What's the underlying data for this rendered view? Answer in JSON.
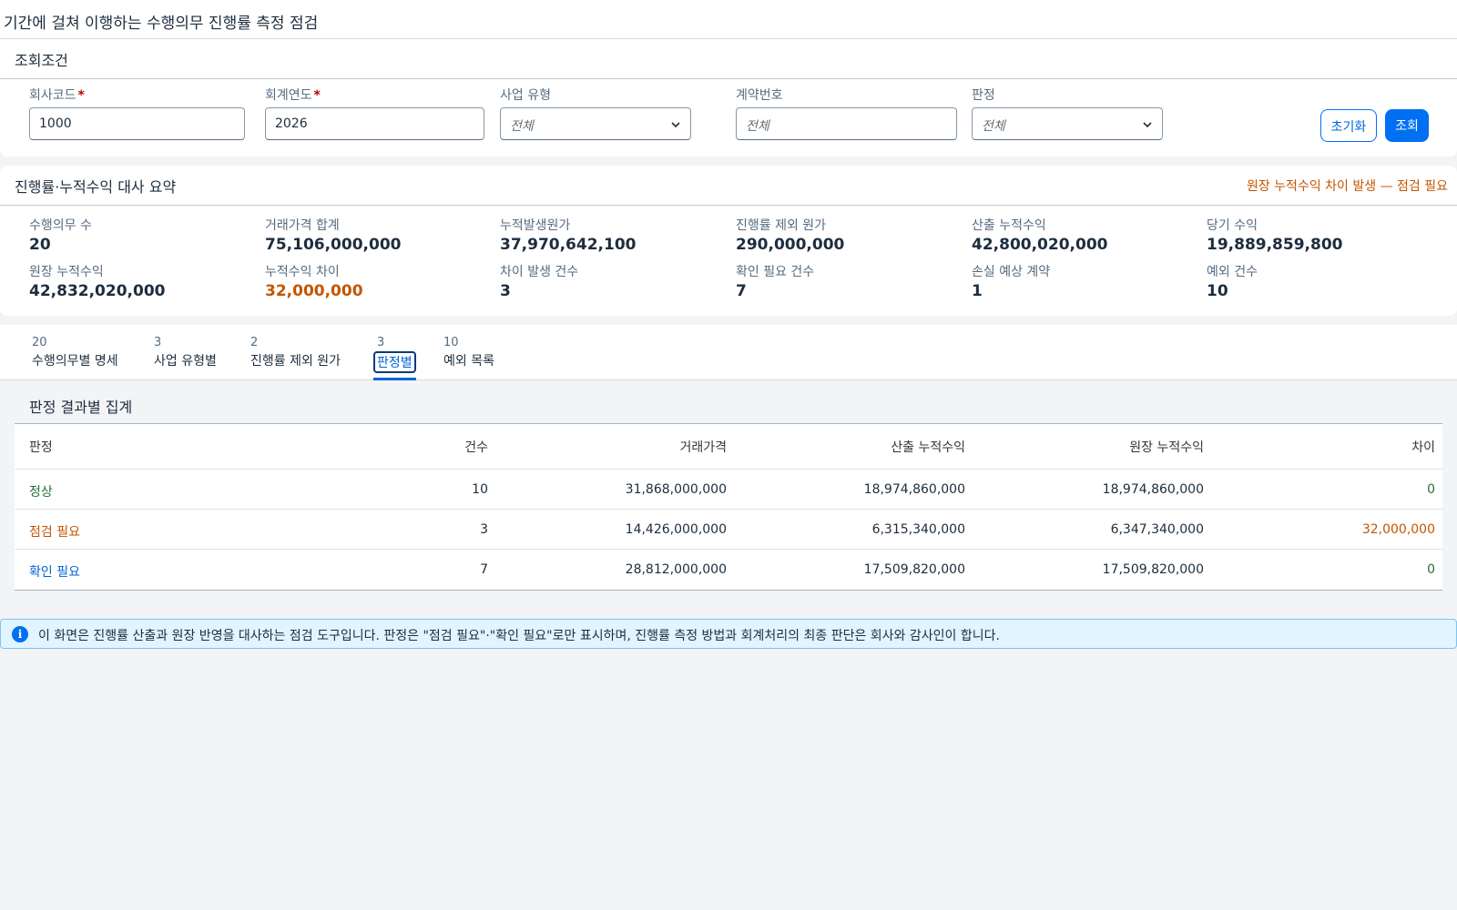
{
  "page": {
    "title": "기간에 걸쳐 이행하는 수행의무 진행률 측정 점검"
  },
  "filters": {
    "title": "조회조건",
    "company_code": {
      "label": "회사코드",
      "value": "1000"
    },
    "fiscal_year": {
      "label": "회계연도",
      "value": "2026"
    },
    "business_type": {
      "label": "사업 유형",
      "value": "전체"
    },
    "contract_no": {
      "label": "계약번호",
      "placeholder": "전체"
    },
    "judgment": {
      "label": "판정",
      "value": "전체"
    },
    "reset_label": "초기화",
    "search_label": "조회"
  },
  "summary": {
    "title": "진행률·누적수익 대사 요약",
    "alert": "원장 누적수익 차이 발생 — 점검 필요",
    "kpis": [
      {
        "label": "수행의무 수",
        "value": "20"
      },
      {
        "label": "거래가격 합계",
        "value": "75,106,000,000"
      },
      {
        "label": "누적발생원가",
        "value": "37,970,642,100"
      },
      {
        "label": "진행률 제외 원가",
        "value": "290,000,000"
      },
      {
        "label": "산출 누적수익",
        "value": "42,800,020,000"
      },
      {
        "label": "당기 수익",
        "value": "19,889,859,800"
      },
      {
        "label": "원장 누적수익",
        "value": "42,832,020,000"
      },
      {
        "label": "누적수익 차이",
        "value": "32,000,000"
      },
      {
        "label": "차이 발생 건수",
        "value": "3"
      },
      {
        "label": "확인 필요 건수",
        "value": "7"
      },
      {
        "label": "손실 예상 계약",
        "value": "1"
      },
      {
        "label": "예외 건수",
        "value": "10"
      }
    ]
  },
  "tabs": [
    {
      "count": "20",
      "label": "수행의무별 명세"
    },
    {
      "count": "3",
      "label": "사업 유형별"
    },
    {
      "count": "2",
      "label": "진행률 제외 원가"
    },
    {
      "count": "3",
      "label": "판정별"
    },
    {
      "count": "10",
      "label": "예외 목록"
    }
  ],
  "active_tab": 3,
  "table": {
    "title": "판정 결과별 집계",
    "headers": [
      "판정",
      "건수",
      "거래가격",
      "산출 누적수익",
      "원장 누적수익",
      "차이"
    ],
    "rows": [
      {
        "judgment": "정상",
        "count": "10",
        "price": "31,868,000,000",
        "calc": "18,974,860,000",
        "ledger": "18,974,860,000",
        "diff": "0"
      },
      {
        "judgment": "점검 필요",
        "count": "3",
        "price": "14,426,000,000",
        "calc": "6,315,340,000",
        "ledger": "6,347,340,000",
        "diff": "32,000,000"
      },
      {
        "judgment": "확인 필요",
        "count": "7",
        "price": "28,812,000,000",
        "calc": "17,509,820,000",
        "ledger": "17,509,820,000",
        "diff": "0"
      }
    ]
  },
  "info": {
    "icon": "info-icon",
    "text": "이 화면은 진행률 산출과 원장 반영을 대사하는 점검 도구입니다. 판정은 \"점검 필요\"·\"확인 필요\"로만 표시하며, 진행률 측정 방법과 회계처리의 최종 판단은 회사와 감사인이 합니다."
  },
  "colors": {
    "accent": "#0070f2",
    "warning": "#c35500",
    "success": "#256f3a",
    "info_bg": "#e1f4ff"
  }
}
